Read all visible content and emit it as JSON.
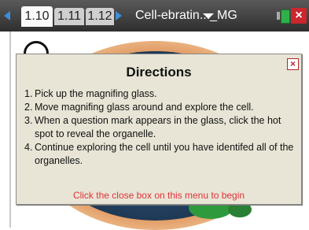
{
  "tabs": [
    {
      "label": "1.10",
      "active": true
    },
    {
      "label": "1.11",
      "active": false
    },
    {
      "label": "1.12",
      "active": false
    }
  ],
  "document_title": "Cell-ebratin..._MG",
  "icons": {
    "prev": "left-arrow-icon",
    "next": "right-arrow-icon",
    "doc_menu": "chevron-down-icon",
    "battery": "battery-icon",
    "close": "close-icon"
  },
  "dialog": {
    "title": "Directions",
    "close_glyph": "×",
    "steps": [
      {
        "num": "1.",
        "text": "Pick up the magnifing glass."
      },
      {
        "num": "2.",
        "text": "Move magnifing glass around and explore the cell."
      },
      {
        "num": "3.",
        "text": "When a question mark appears in the glass, click the hot spot to reveal the organelle."
      },
      {
        "num": "4.",
        "text": "Continue exploring the cell until you have identifed all of the organelles."
      }
    ],
    "footer": "Click the close box on this menu to begin"
  },
  "colors": {
    "accent": "#3b8ed8",
    "dialog_bg": "#e8e5d6",
    "footer_text": "#e23236",
    "close_red": "#c9262e"
  }
}
